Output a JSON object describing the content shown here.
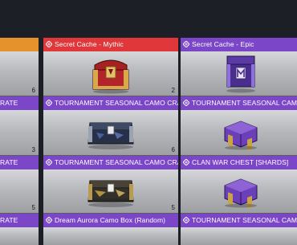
{
  "grid": {
    "left_column": {
      "cells": [
        {
          "header": "",
          "count": "6"
        },
        {
          "header": "RATE",
          "count": "3"
        },
        {
          "header": "RATE",
          "count": "5"
        },
        {
          "header": "RATE"
        }
      ]
    },
    "middle_column": {
      "cells": [
        {
          "header": "Secret Cache - Mythic",
          "item": "mythic-crate-icon",
          "count": "2",
          "color": "#e0373a"
        },
        {
          "header": "TOURNAMENT SEASONAL CAMO CRATE",
          "item": "blue-camo-crate-icon",
          "count": "6"
        },
        {
          "header": "TOURNAMENT SEASONAL CAMO CRATE",
          "item": "gold-camo-crate-icon",
          "count": "5"
        },
        {
          "header": "Dream Aurora Camo Box (Random)"
        }
      ]
    },
    "right_column": {
      "cells": [
        {
          "header": "Secret Cache - Epic",
          "item": "epic-crate-icon",
          "color": "#7b47c8"
        },
        {
          "header": "TOURNAMENT SEASONAL CAMO CRATE",
          "item": "purple-chest-icon"
        },
        {
          "header": "CLAN WAR CHEST [SHARDS]",
          "item": "purple-chest-icon"
        },
        {
          "header": "TOURNAMENT SEASONAL CAMO CRATE"
        }
      ]
    }
  },
  "colors": {
    "mythic": "#e0373a",
    "epic": "#7b47c8",
    "legendary": "#e5922c",
    "background": "#1c1f26"
  }
}
